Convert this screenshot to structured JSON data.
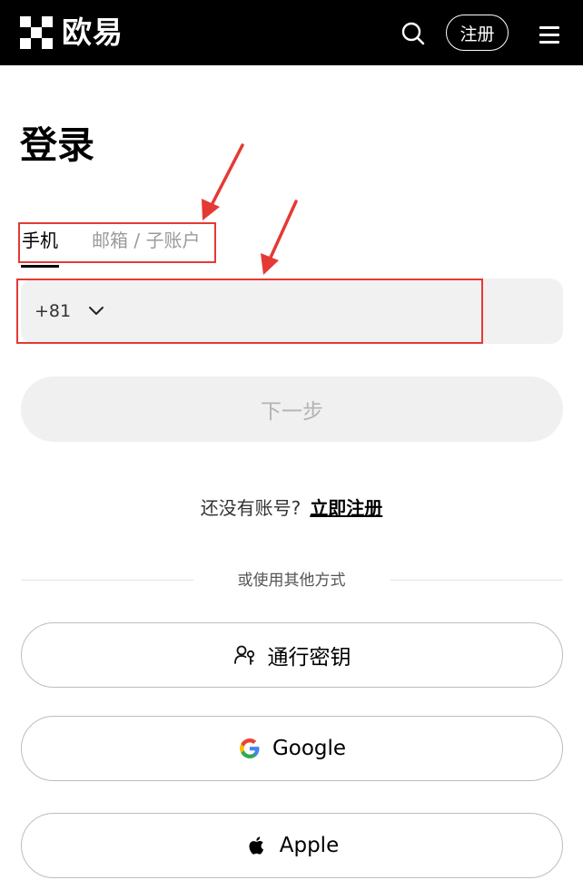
{
  "header": {
    "brand": "欧易",
    "search_icon": "search-icon",
    "register_label": "注册",
    "menu_icon": "menu-icon"
  },
  "login": {
    "title": "登录",
    "tabs": [
      {
        "label": "手机",
        "active": true
      },
      {
        "label": "邮箱 / 子账户",
        "active": false
      }
    ],
    "country_code": "+81",
    "next_label": "下一步",
    "no_account_text": "还没有账号?",
    "signup_link": "立即注册",
    "divider_text": "或使用其他方式",
    "alt_methods": [
      {
        "label": "通行密钥",
        "icon": "passkey-icon"
      },
      {
        "label": "Google",
        "icon": "google-icon"
      },
      {
        "label": "Apple",
        "icon": "apple-icon"
      }
    ]
  },
  "colors": {
    "header_bg": "#000000",
    "annotation": "#e53935",
    "input_bg": "#f1f1f1"
  }
}
